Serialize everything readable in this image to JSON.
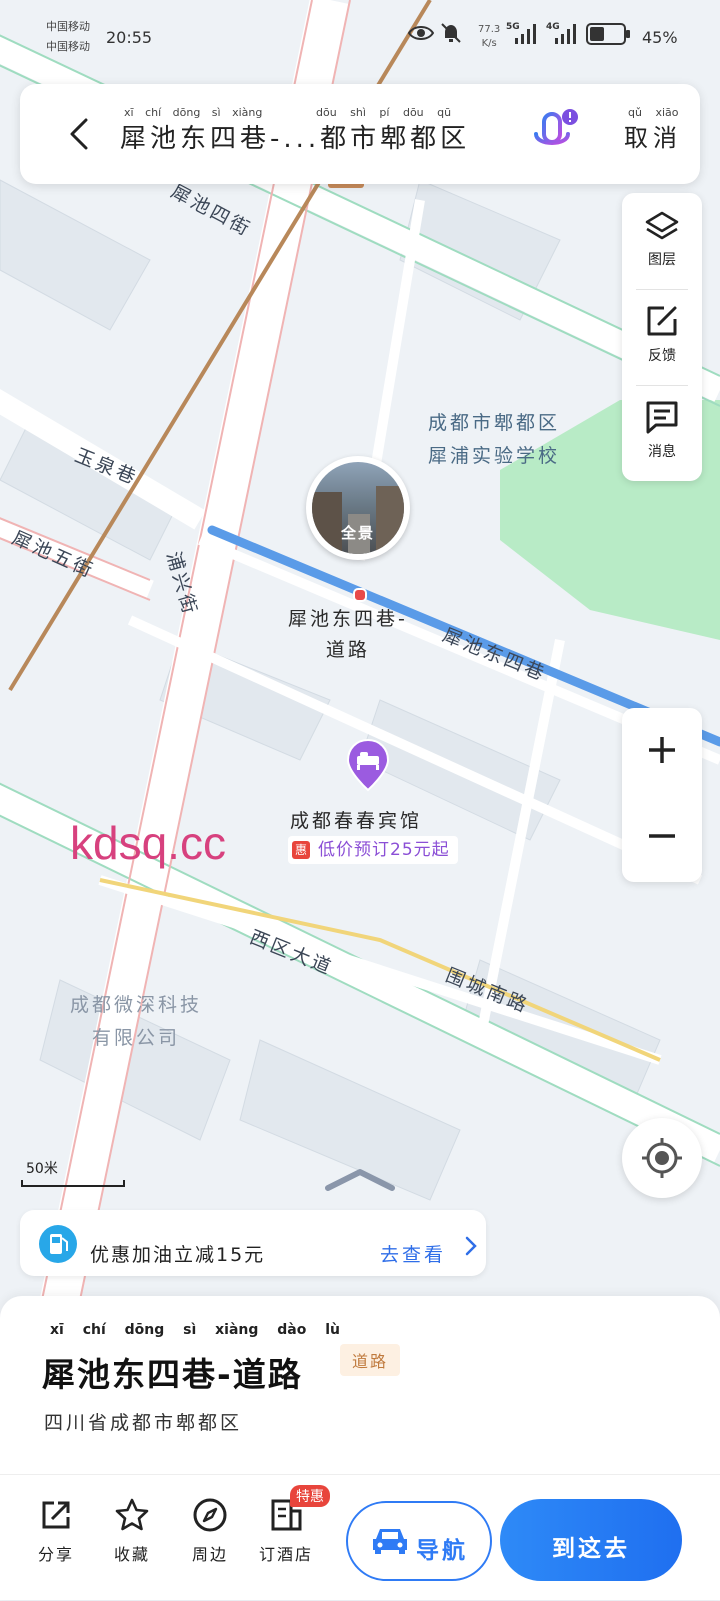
{
  "status_bar": {
    "carrier_1": "中国移动",
    "carrier_2": "中国移动",
    "time": "20:55",
    "net_speed_value": "77.3",
    "net_speed_unit": "K/s",
    "signal_1_label": "5G",
    "signal_2_label": "4G",
    "battery_pct": "45%",
    "battery_level": 0.45,
    "icons": [
      "eye-icon",
      "bell-muted-icon"
    ]
  },
  "search_bar": {
    "title": "犀池东四巷-...都市郫都区",
    "title_pinyin_left": "xī chí dōng sì xiàng",
    "title_pinyin_right": "dōu shì pí dōu qū",
    "cancel_label": "取消",
    "cancel_pinyin": "qǔ xiāo"
  },
  "right_tools": [
    {
      "label": "图层",
      "pinyin": "tú céng",
      "icon": "layers-icon"
    },
    {
      "label": "反馈",
      "pinyin": "fǎn kuì",
      "icon": "feedback-icon"
    },
    {
      "label": "消息",
      "pinyin": "xiāo xī",
      "icon": "message-icon"
    }
  ],
  "map": {
    "streets": [
      {
        "text": "犀池四街",
        "pinyin": "xī chí sì jiē"
      },
      {
        "text": "玉泉巷",
        "pinyin": "yù quán xiàng"
      },
      {
        "text": "犀池五街",
        "pinyin": "xī chí wǔ jiē"
      },
      {
        "text": "浦兴街",
        "pinyin": "pǔ xīng jiē"
      },
      {
        "text": "犀池东四巷",
        "pinyin": "xī chí dōng sì xiàng"
      },
      {
        "text": "西区大道",
        "pinyin": "xī qū dà dào"
      },
      {
        "text": "围城南路",
        "pinyin": "wéi chéng nán lù"
      }
    ],
    "school_line_1": "成都市郫都区",
    "school_line_2": "犀浦实验学校",
    "company_line_1": "成都微深科技",
    "company_line_2": "有限公司",
    "panorama_label": "全景",
    "pin_label_line_1": "犀池东四巷-",
    "pin_label_line_2": "道路",
    "hotel_name": "成都春春宾馆",
    "hotel_promo": "低价预订25元起",
    "scale": "50米"
  },
  "fuel_promo": {
    "text": "优惠加油立减15元",
    "link": "去查看"
  },
  "place": {
    "title": "犀池东四巷-道路",
    "title_pinyin": "xī chí dōng sì xiàng dào lù",
    "tag": "道路",
    "address": "四川省成都市郫都区"
  },
  "actions": {
    "share": "分享",
    "favorite": "收藏",
    "nearby": "周边",
    "hotel": "订酒店",
    "hotel_badge": "特惠",
    "navigate": "导航",
    "go_here": "到这去"
  },
  "watermark": "kdsq.cc",
  "colors": {
    "accent_blue": "#2f7bf5",
    "road_highlight": "#5a9be8",
    "green_area": "#b9ebc8",
    "mic_purple": "#7b4fe0",
    "hotel_pin": "#9b5be0",
    "badge_red": "#e8453c"
  }
}
